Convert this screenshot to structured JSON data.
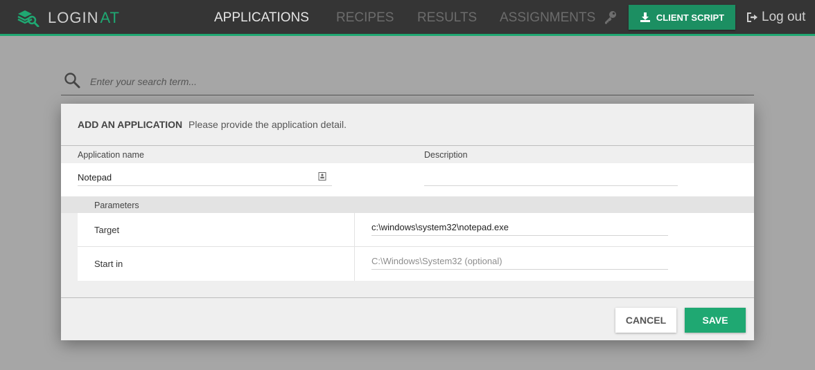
{
  "header": {
    "brand_main": "LOGIN",
    "brand_accent": "AT",
    "nav": [
      {
        "label": "APPLICATIONS",
        "active": true
      },
      {
        "label": "RECIPES",
        "active": false
      },
      {
        "label": "RESULTS",
        "active": false
      },
      {
        "label": "ASSIGNMENTS",
        "active": false
      }
    ],
    "client_script_label": "CLIENT SCRIPT",
    "logout_label": "Log out",
    "accent_color": "#1fa872"
  },
  "search": {
    "placeholder": "Enter your search term..."
  },
  "dialog": {
    "title": "ADD AN APPLICATION",
    "subtitle": "Please provide the application detail.",
    "app_name_label": "Application name",
    "app_name_value": "Notepad",
    "description_label": "Description",
    "description_value": "",
    "parameters_label": "Parameters",
    "params": [
      {
        "name": "Target",
        "value": "c:\\windows\\system32\\notepad.exe",
        "placeholder": ""
      },
      {
        "name": "Start in",
        "value": "",
        "placeholder": "C:\\Windows\\System32 (optional)"
      }
    ],
    "cancel_label": "CANCEL",
    "save_label": "SAVE"
  },
  "icons": {
    "logo": "stacked-layers-magnifier-icon",
    "key": "key-icon",
    "download": "download-icon",
    "logout": "sign-out-icon",
    "search": "magnifier-icon",
    "field": "contact-card-icon"
  }
}
